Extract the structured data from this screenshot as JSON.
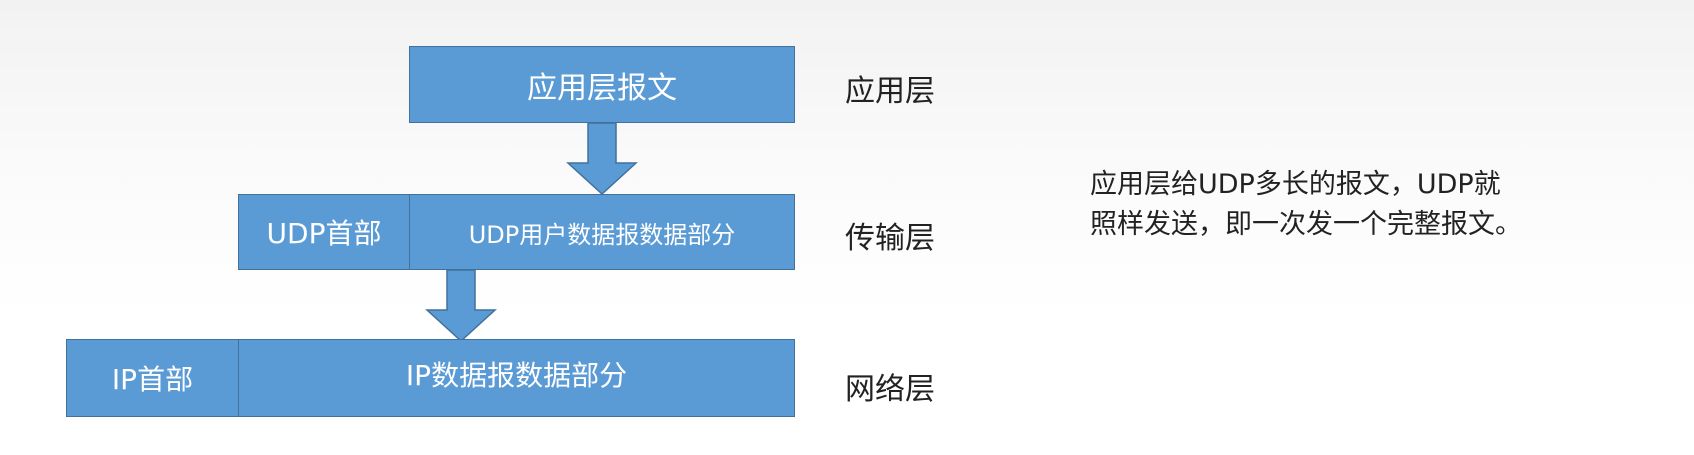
{
  "application_layer": {
    "message_box": "应用层报文",
    "layer_label": "应用层"
  },
  "transport_layer": {
    "header_box": "UDP首部",
    "data_box": "UDP用户数据报数据部分",
    "layer_label": "传输层"
  },
  "network_layer": {
    "header_box": "IP首部",
    "data_box": "IP数据报数据部分",
    "layer_label": "网络层"
  },
  "note": {
    "line1": "应用层给UDP多长的报文，UDP就",
    "line2": "照样发送，即一次发一个完整报文。"
  },
  "colors": {
    "box_fill": "#5b9bd5",
    "box_border": "#41719c",
    "text_dark": "#222222"
  }
}
